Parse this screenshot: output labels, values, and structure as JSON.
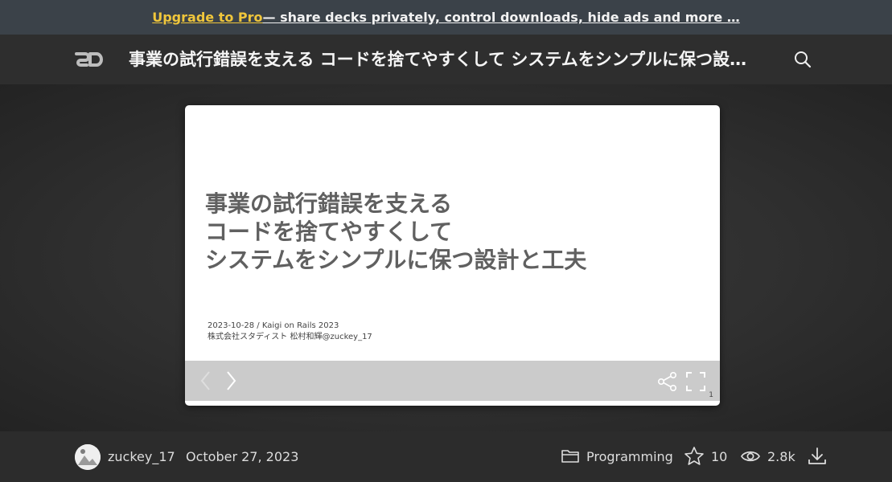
{
  "promo": {
    "link_text": "Upgrade to Pro",
    "message": " — share decks privately, control downloads, hide ads and more …"
  },
  "header": {
    "logo_text": "SD",
    "title": "事業の試行錯誤を支える コードを捨てやすくして システムをシンプルに保つ設計と工夫",
    "icons": {
      "search": "search-icon"
    }
  },
  "slide": {
    "title_lines": [
      "事業の試行錯誤を支える",
      "コードを捨てやすくして",
      "システムをシンプルに保つ設計と工夫"
    ],
    "meta_line1": "2023-10-28 / Kaigi on Rails 2023",
    "meta_line2": "株式会社スタディスト 松村和輝@zuckey_17",
    "page_number": "1",
    "controls": {
      "prev": "chevron-left-icon",
      "next": "chevron-right-icon",
      "share": "share-icon",
      "fullscreen": "fullscreen-icon"
    }
  },
  "footer": {
    "author": "zuckey_17",
    "date": "October 27, 2023",
    "category": "Programming",
    "stars": "10",
    "views": "2.8k",
    "icons": {
      "category": "folder-icon",
      "stars": "star-icon",
      "views": "eye-icon",
      "download": "download-icon"
    }
  },
  "colors": {
    "promo_bg": "#3b4249",
    "pro_link": "#f0c63b",
    "header_bg": "#2e2e2e",
    "controls_bg": "#cbcbcb"
  }
}
